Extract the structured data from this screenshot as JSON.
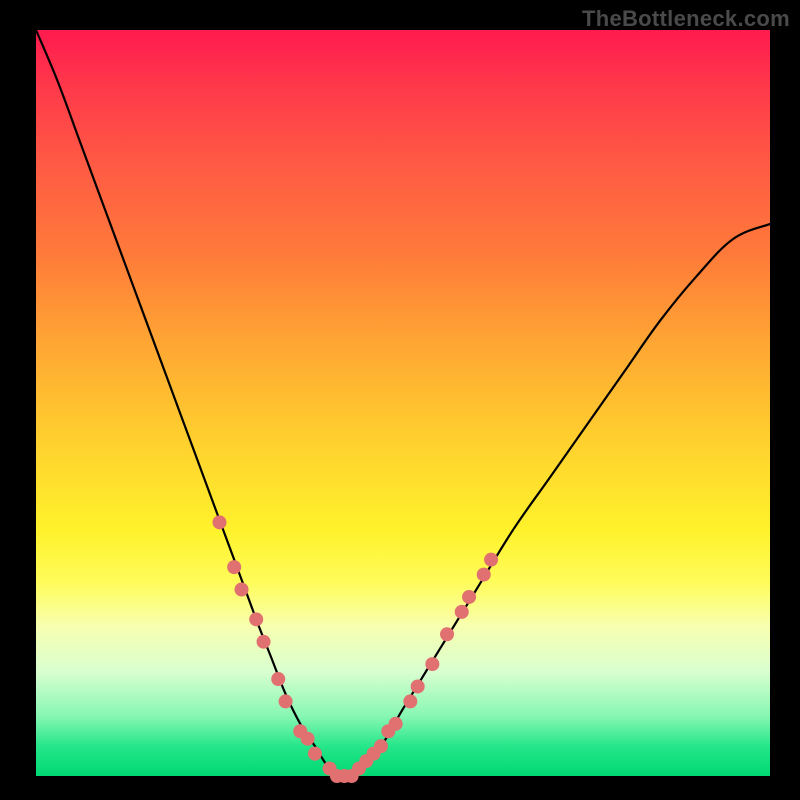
{
  "watermark": "TheBottleneck.com",
  "colors": {
    "frame": "#000000",
    "curve": "#000000",
    "marker_fill": "#e17070",
    "grad_top": "#ff1a4f",
    "grad_bottom": "#00d873"
  },
  "chart_data": {
    "type": "line",
    "title": "",
    "xlabel": "",
    "ylabel": "",
    "xlim": [
      0,
      100
    ],
    "ylim": [
      0,
      100
    ],
    "grid": false,
    "x": [
      0,
      3,
      6,
      9,
      12,
      15,
      18,
      21,
      24,
      27,
      30,
      32,
      34,
      36,
      38,
      40,
      42,
      44,
      47,
      50,
      55,
      60,
      65,
      70,
      75,
      80,
      85,
      90,
      95,
      100
    ],
    "y": [
      100,
      93,
      85,
      77,
      69,
      61,
      53,
      45,
      37,
      29,
      21,
      16,
      11,
      7,
      4,
      1,
      0,
      1,
      4,
      9,
      17,
      25,
      33,
      40,
      47,
      54,
      61,
      67,
      72,
      74
    ],
    "markers": [
      {
        "x": 25,
        "y": 34
      },
      {
        "x": 27,
        "y": 28
      },
      {
        "x": 28,
        "y": 25
      },
      {
        "x": 30,
        "y": 21
      },
      {
        "x": 31,
        "y": 18
      },
      {
        "x": 33,
        "y": 13
      },
      {
        "x": 34,
        "y": 10
      },
      {
        "x": 36,
        "y": 6
      },
      {
        "x": 37,
        "y": 5
      },
      {
        "x": 38,
        "y": 3
      },
      {
        "x": 40,
        "y": 1
      },
      {
        "x": 41,
        "y": 0
      },
      {
        "x": 42,
        "y": 0
      },
      {
        "x": 43,
        "y": 0
      },
      {
        "x": 44,
        "y": 1
      },
      {
        "x": 45,
        "y": 2
      },
      {
        "x": 46,
        "y": 3
      },
      {
        "x": 47,
        "y": 4
      },
      {
        "x": 48,
        "y": 6
      },
      {
        "x": 49,
        "y": 7
      },
      {
        "x": 51,
        "y": 10
      },
      {
        "x": 52,
        "y": 12
      },
      {
        "x": 54,
        "y": 15
      },
      {
        "x": 56,
        "y": 19
      },
      {
        "x": 58,
        "y": 22
      },
      {
        "x": 59,
        "y": 24
      },
      {
        "x": 61,
        "y": 27
      },
      {
        "x": 62,
        "y": 29
      }
    ],
    "marker_radius_px": 7
  }
}
